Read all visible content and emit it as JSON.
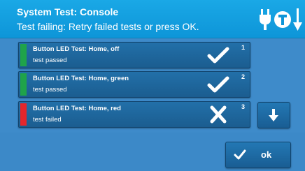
{
  "header": {
    "title": "System Test: Console",
    "subtitle": "Test failing: Retry failed tests or press OK.",
    "icons": [
      "power-plug-icon",
      "touch-t-icon",
      "down-arrow-icon"
    ]
  },
  "tests": [
    {
      "index": "1",
      "name": "Button LED Test: Home, off",
      "result": "test passed",
      "status": "pass",
      "icon": "checkmark-icon"
    },
    {
      "index": "2",
      "name": "Button LED Test: Home, green",
      "result": "test passed",
      "status": "pass",
      "icon": "checkmark-icon"
    },
    {
      "index": "3",
      "name": "Button LED Test: Home, red",
      "result": "test failed",
      "status": "fail",
      "icon": "x-icon"
    }
  ],
  "scroll": {
    "icon": "arrow-down-icon"
  },
  "footer": {
    "ok_label": "ok",
    "ok_icon": "checkmark-icon"
  },
  "colors": {
    "header": "#10a0e0",
    "panel": "#3c89c8",
    "row": "#1e66a0",
    "pass": "#1fa34a",
    "fail": "#e4262c"
  }
}
